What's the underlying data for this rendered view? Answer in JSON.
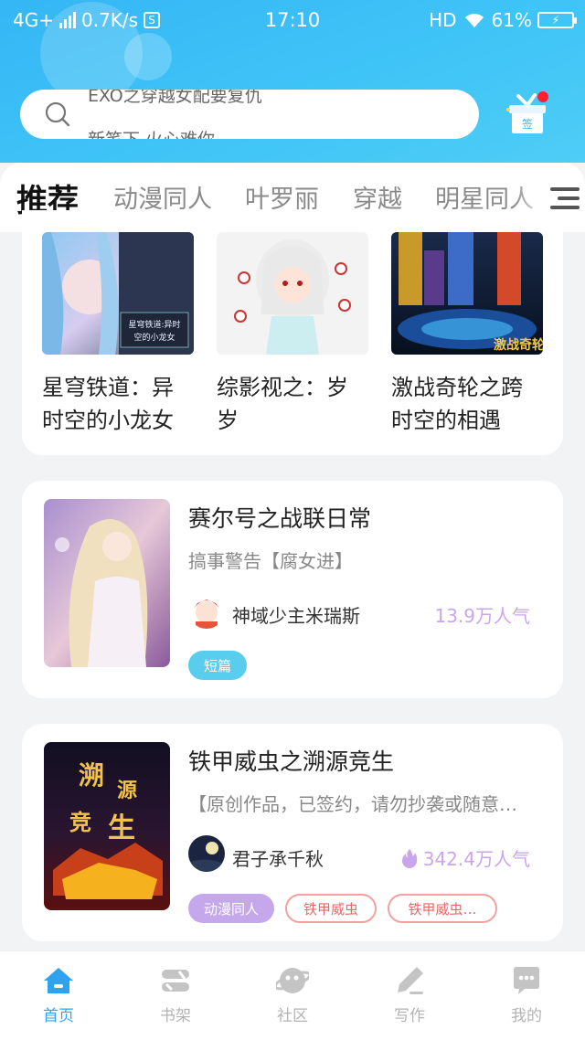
{
  "status_bar": {
    "network": "4G+",
    "speed": "0.7K/s",
    "s_badge": "S",
    "time": "17:10",
    "hd": "HD",
    "battery": "61%"
  },
  "search": {
    "line1": "EXO之穿越女配要复仇",
    "line2": "新笔下 火心难你"
  },
  "tabs": [
    "推荐",
    "动漫同人",
    "叶罗丽",
    "穿越",
    "明星同人"
  ],
  "top_books": [
    {
      "title": "星穹铁道：异时空的小龙女",
      "cover_text": "星穹铁道:异时空的小龙女"
    },
    {
      "title": "综影视之：岁岁"
    },
    {
      "title": "激战奇轮之跨时空的相遇",
      "cover_text": "激战奇轮"
    }
  ],
  "books": [
    {
      "title": "赛尔号之战联日常",
      "desc": "搞事警告【腐女进】",
      "author": "神域少主米瑞斯",
      "popularity": "13.9万人气",
      "tags": [
        "短篇"
      ]
    },
    {
      "title": "铁甲威虫之溯源竞生",
      "desc": "【原创作品，已签约，请勿抄袭或随意…",
      "author": "君子承千秋",
      "popularity": "342.4万人气",
      "cover_text": "溯源竞生",
      "tags": [
        "动漫同人",
        "铁甲威虫",
        "铁甲威虫…"
      ]
    }
  ],
  "bottom_nav": [
    "首页",
    "书架",
    "社区",
    "写作",
    "我的"
  ],
  "colors": {
    "header": "#3fc4f7",
    "accent_purple": "#9b7cf4",
    "nav_active": "#2fa3f0",
    "popularity": "#c9a6ec"
  },
  "icons": {
    "search": "search-icon",
    "gift": "gift-sign-in-icon",
    "menu": "menu-icon",
    "flame": "flame-icon",
    "home": "home-icon",
    "bookshelf": "bookshelf-icon",
    "community": "community-icon",
    "write": "pen-icon",
    "mine": "chat-bubble-icon"
  }
}
